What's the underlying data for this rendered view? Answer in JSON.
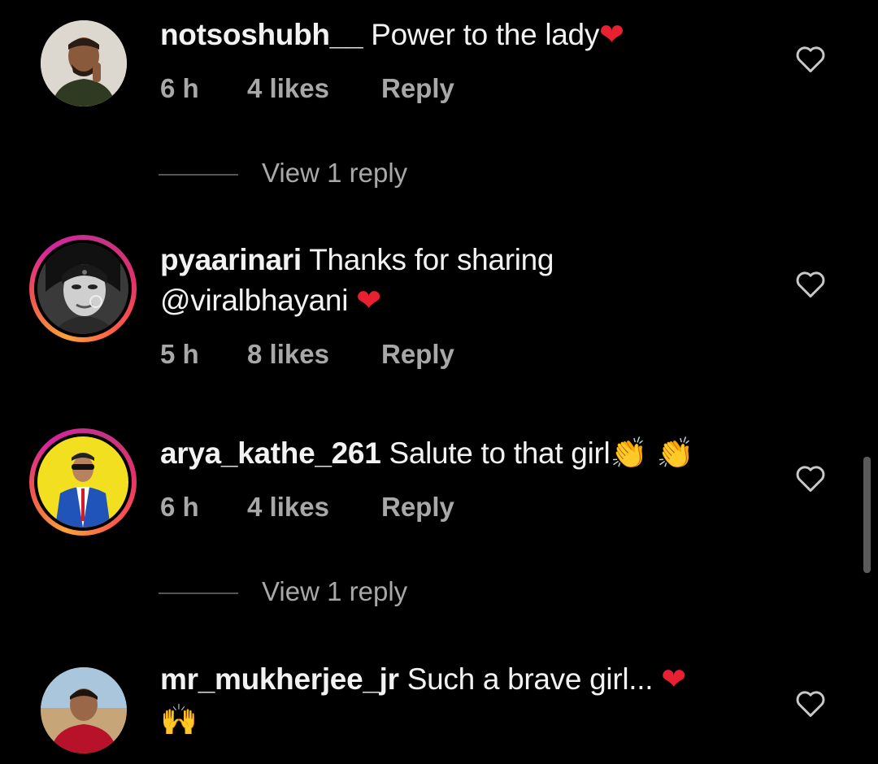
{
  "comments": [
    {
      "username": "notsoshubh__",
      "text": "Power to the lady",
      "text2": "",
      "time": "6 h",
      "likes": "4 likes",
      "reply": "Reply",
      "view_replies": "View 1 reply"
    },
    {
      "username": "pyaarinari",
      "text": "Thanks for sharing",
      "text2": "@viralbhayani",
      "time": "5 h",
      "likes": "8 likes",
      "reply": "Reply",
      "view_replies": ""
    },
    {
      "username": "arya_kathe_261",
      "text": "Salute to that girl",
      "text2": "",
      "time": "6 h",
      "likes": "4 likes",
      "reply": "Reply",
      "view_replies": "View 1 reply"
    },
    {
      "username": "mr_mukherjee_jr",
      "text": "Such a brave girl...",
      "text2": "",
      "time": "",
      "likes": "",
      "reply": "",
      "view_replies": ""
    }
  ],
  "colors": {
    "background": "#000000",
    "meta": "#a8a8a8",
    "heart": "#e8202f"
  },
  "icons": {
    "like": "heart-outline-icon",
    "emoji_heart": "red-heart-emoji",
    "emoji_clap": "clapping-hands-emoji",
    "emoji_raise": "raising-hands-emoji"
  }
}
